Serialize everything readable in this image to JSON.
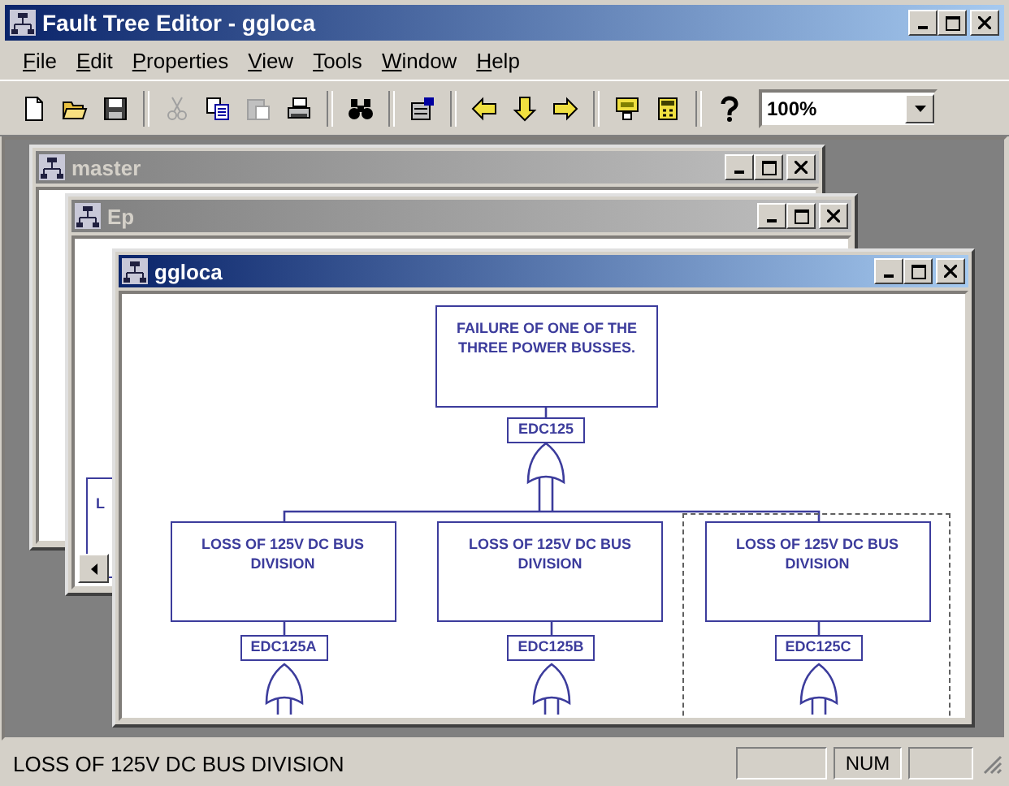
{
  "window": {
    "title": "Fault Tree Editor - ggloca"
  },
  "menu": [
    {
      "label": "File"
    },
    {
      "label": "Edit"
    },
    {
      "label": "Properties"
    },
    {
      "label": "View"
    },
    {
      "label": "Tools"
    },
    {
      "label": "Window"
    },
    {
      "label": "Help"
    }
  ],
  "toolbar": {
    "buttons": [
      {
        "kind": "new",
        "disabled": false
      },
      {
        "kind": "open",
        "disabled": false
      },
      {
        "kind": "save",
        "disabled": false
      },
      {
        "kind": "sep"
      },
      {
        "kind": "cut",
        "disabled": true
      },
      {
        "kind": "copy",
        "disabled": false
      },
      {
        "kind": "paste",
        "disabled": true
      },
      {
        "kind": "print",
        "disabled": false
      },
      {
        "kind": "sep"
      },
      {
        "kind": "find",
        "disabled": false
      },
      {
        "kind": "sep"
      },
      {
        "kind": "properties",
        "disabled": false
      },
      {
        "kind": "sep"
      },
      {
        "kind": "left",
        "disabled": false
      },
      {
        "kind": "down",
        "disabled": false
      },
      {
        "kind": "right",
        "disabled": false
      },
      {
        "kind": "sep"
      },
      {
        "kind": "chip",
        "disabled": false
      },
      {
        "kind": "calc",
        "disabled": false
      },
      {
        "kind": "sep"
      },
      {
        "kind": "help",
        "disabled": false
      }
    ],
    "zoom": "100%"
  },
  "mdi_windows": [
    {
      "title": "master",
      "active": false
    },
    {
      "title": "Ep",
      "active": false,
      "visible_text": "L"
    },
    {
      "title": "ggloca",
      "active": true
    }
  ],
  "fault_tree": {
    "description": "FAILURE OF ONE OF THE THREE POWER BUSSES.",
    "id": "EDC125",
    "kind": "or",
    "children": [
      {
        "description": "LOSS OF 125V DC BUS DIVISION",
        "id": "EDC125A",
        "kind": "or",
        "selected": false
      },
      {
        "description": "LOSS OF 125V DC BUS DIVISION",
        "id": "EDC125B",
        "kind": "or",
        "selected": false
      },
      {
        "description": "LOSS OF 125V DC BUS DIVISION",
        "id": "EDC125C",
        "kind": "or",
        "selected": true
      }
    ]
  },
  "status_bar": {
    "message": "LOSS OF 125V DC BUS DIVISION",
    "num_indicator": "NUM"
  }
}
